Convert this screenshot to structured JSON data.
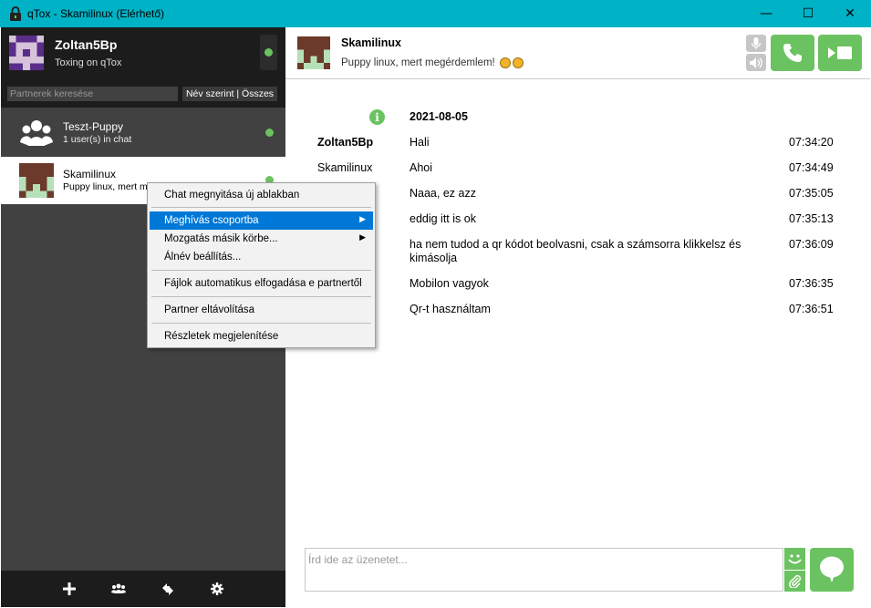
{
  "window": {
    "title": "qTox - Skamilinux (Elérhető)",
    "minimize": "—",
    "maximize": "☐",
    "close": "✕"
  },
  "profile": {
    "name": "Zoltan5Bp",
    "status_message": "Toxing on qTox",
    "status_color": "#6bc260"
  },
  "search": {
    "placeholder": "Partnerek keresése",
    "filter_label": "Név szerint | Összes"
  },
  "contacts": [
    {
      "name": "Teszt-Puppy",
      "subtitle": "1 user(s) in chat",
      "type": "group"
    },
    {
      "name": "Skamilinux",
      "subtitle": "Puppy linux, mert m",
      "type": "friend",
      "selected": true
    }
  ],
  "chat_header": {
    "name": "Skamilinux",
    "status": "Puppy linux, mert megérdemlem!"
  },
  "messages": {
    "date": "2021-08-05",
    "items": [
      {
        "author": "Zoltan5Bp",
        "text": "Hali",
        "time": "07:34:20"
      },
      {
        "author": "Skamilinux",
        "text": "Ahoi",
        "time": "07:34:49"
      },
      {
        "author": "",
        "text": "Naaa, ez azz",
        "time": "07:35:05"
      },
      {
        "author": "",
        "text": "eddig itt is ok",
        "time": "07:35:13"
      },
      {
        "author": "",
        "text": "ha nem tudod a qr kódot beolvasni, csak a számsorra klikkelsz és kimásolja",
        "time": "07:36:09"
      },
      {
        "author": "",
        "text": "Mobilon vagyok",
        "time": "07:36:35"
      },
      {
        "author": "",
        "text": "Qr-t használtam",
        "time": "07:36:51"
      }
    ]
  },
  "input": {
    "placeholder": "Írd ide az üzenetet..."
  },
  "context_menu": {
    "items": [
      "Chat megnyitása új ablakban",
      "Meghívás csoportba",
      "Mozgatás másik körbe...",
      "Álnév beállítás...",
      "Fájlok automatikus elfogadása e partnertől",
      "Partner eltávolítása",
      "Részletek megjelenítése"
    ],
    "highlighted": "Meghívás csoportba"
  },
  "colors": {
    "titlebar": "#00b2c5",
    "accent": "#6bc260",
    "sidebar": "#414141",
    "sidebar_dark": "#1c1c1c",
    "menu_highlight": "#0078d7"
  }
}
